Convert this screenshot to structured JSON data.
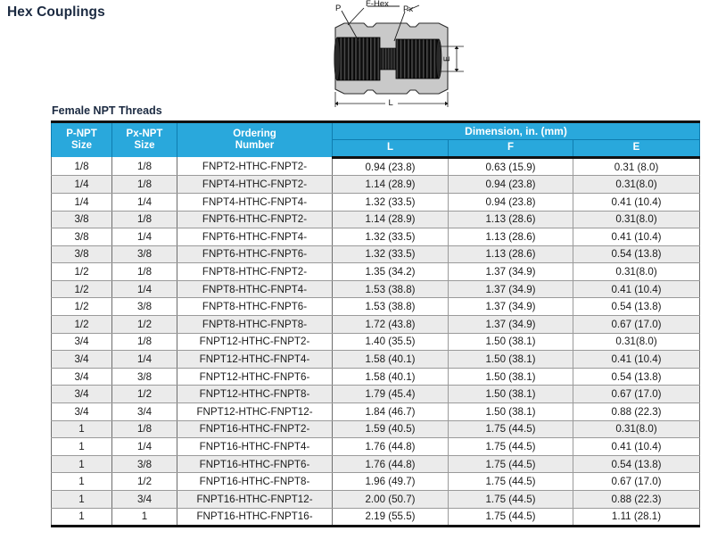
{
  "page_title": "Hex Couplings",
  "section_label": "Female NPT Threads",
  "colors": {
    "header_blue": "#29a8dc",
    "title_navy": "#1b2a41",
    "row_alt_gray": "#ebebeb",
    "rule_black": "#111111",
    "drawing_body_gray": "#c9c9c9",
    "drawing_thread_dark": "#1c1c1c"
  },
  "drawing": {
    "name": "hex-coupling-cross-section",
    "labels": {
      "p": "P",
      "f_hex": "F-Hex",
      "px": "Px",
      "e": "E",
      "l": "L"
    }
  },
  "table": {
    "group_header": "Dimension, in. (mm)",
    "columns": [
      {
        "key": "p_npt_size",
        "label_line1": "P-NPT",
        "label_line2": "Size"
      },
      {
        "key": "px_npt_size",
        "label_line1": "Px-NPT",
        "label_line2": "Size"
      },
      {
        "key": "ordering_number",
        "label_line1": "Ordering",
        "label_line2": "Number"
      },
      {
        "key": "l",
        "label": "L"
      },
      {
        "key": "f",
        "label": "F"
      },
      {
        "key": "e",
        "label": "E"
      }
    ],
    "rows": [
      {
        "p": "1/8",
        "px": "1/8",
        "order": "FNPT2-HTHC-FNPT2-",
        "l": "0.94 (23.8)",
        "f": "0.63 (15.9)",
        "e": "0.31 (8.0)"
      },
      {
        "p": "1/4",
        "px": "1/8",
        "order": "FNPT4-HTHC-FNPT2-",
        "l": "1.14 (28.9)",
        "f": "0.94 (23.8)",
        "e": "0.31(8.0)"
      },
      {
        "p": "1/4",
        "px": "1/4",
        "order": "FNPT4-HTHC-FNPT4-",
        "l": "1.32 (33.5)",
        "f": "0.94 (23.8)",
        "e": "0.41 (10.4)"
      },
      {
        "p": "3/8",
        "px": "1/8",
        "order": "FNPT6-HTHC-FNPT2-",
        "l": "1.14 (28.9)",
        "f": "1.13 (28.6)",
        "e": "0.31(8.0)"
      },
      {
        "p": "3/8",
        "px": "1/4",
        "order": "FNPT6-HTHC-FNPT4-",
        "l": "1.32 (33.5)",
        "f": "1.13 (28.6)",
        "e": "0.41 (10.4)"
      },
      {
        "p": "3/8",
        "px": "3/8",
        "order": "FNPT6-HTHC-FNPT6-",
        "l": "1.32 (33.5)",
        "f": "1.13 (28.6)",
        "e": "0.54 (13.8)"
      },
      {
        "p": "1/2",
        "px": "1/8",
        "order": "FNPT8-HTHC-FNPT2-",
        "l": "1.35 (34.2)",
        "f": "1.37 (34.9)",
        "e": "0.31(8.0)"
      },
      {
        "p": "1/2",
        "px": "1/4",
        "order": "FNPT8-HTHC-FNPT4-",
        "l": "1.53 (38.8)",
        "f": "1.37 (34.9)",
        "e": "0.41 (10.4)"
      },
      {
        "p": "1/2",
        "px": "3/8",
        "order": "FNPT8-HTHC-FNPT6-",
        "l": "1.53 (38.8)",
        "f": "1.37 (34.9)",
        "e": "0.54 (13.8)"
      },
      {
        "p": "1/2",
        "px": "1/2",
        "order": "FNPT8-HTHC-FNPT8-",
        "l": "1.72 (43.8)",
        "f": "1.37 (34.9)",
        "e": "0.67 (17.0)"
      },
      {
        "p": "3/4",
        "px": "1/8",
        "order": "FNPT12-HTHC-FNPT2-",
        "l": "1.40 (35.5)",
        "f": "1.50 (38.1)",
        "e": "0.31(8.0)"
      },
      {
        "p": "3/4",
        "px": "1/4",
        "order": "FNPT12-HTHC-FNPT4-",
        "l": "1.58 (40.1)",
        "f": "1.50 (38.1)",
        "e": "0.41 (10.4)"
      },
      {
        "p": "3/4",
        "px": "3/8",
        "order": "FNPT12-HTHC-FNPT6-",
        "l": "1.58 (40.1)",
        "f": "1.50 (38.1)",
        "e": "0.54 (13.8)"
      },
      {
        "p": "3/4",
        "px": "1/2",
        "order": "FNPT12-HTHC-FNPT8-",
        "l": "1.79 (45.4)",
        "f": "1.50 (38.1)",
        "e": "0.67 (17.0)"
      },
      {
        "p": "3/4",
        "px": "3/4",
        "order": "FNPT12-HTHC-FNPT12-",
        "l": "1.84 (46.7)",
        "f": "1.50 (38.1)",
        "e": "0.88 (22.3)"
      },
      {
        "p": "1",
        "px": "1/8",
        "order": "FNPT16-HTHC-FNPT2-",
        "l": "1.59 (40.5)",
        "f": "1.75 (44.5)",
        "e": "0.31(8.0)"
      },
      {
        "p": "1",
        "px": "1/4",
        "order": "FNPT16-HTHC-FNPT4-",
        "l": "1.76 (44.8)",
        "f": "1.75 (44.5)",
        "e": "0.41 (10.4)"
      },
      {
        "p": "1",
        "px": "3/8",
        "order": "FNPT16-HTHC-FNPT6-",
        "l": "1.76 (44.8)",
        "f": "1.75 (44.5)",
        "e": "0.54 (13.8)"
      },
      {
        "p": "1",
        "px": "1/2",
        "order": "FNPT16-HTHC-FNPT8-",
        "l": "1.96 (49.7)",
        "f": "1.75 (44.5)",
        "e": "0.67 (17.0)"
      },
      {
        "p": "1",
        "px": "3/4",
        "order": "FNPT16-HTHC-FNPT12-",
        "l": "2.00 (50.7)",
        "f": "1.75 (44.5)",
        "e": "0.88 (22.3)"
      },
      {
        "p": "1",
        "px": "1",
        "order": "FNPT16-HTHC-FNPT16-",
        "l": "2.19 (55.5)",
        "f": "1.75 (44.5)",
        "e": "1.11 (28.1)"
      }
    ]
  }
}
